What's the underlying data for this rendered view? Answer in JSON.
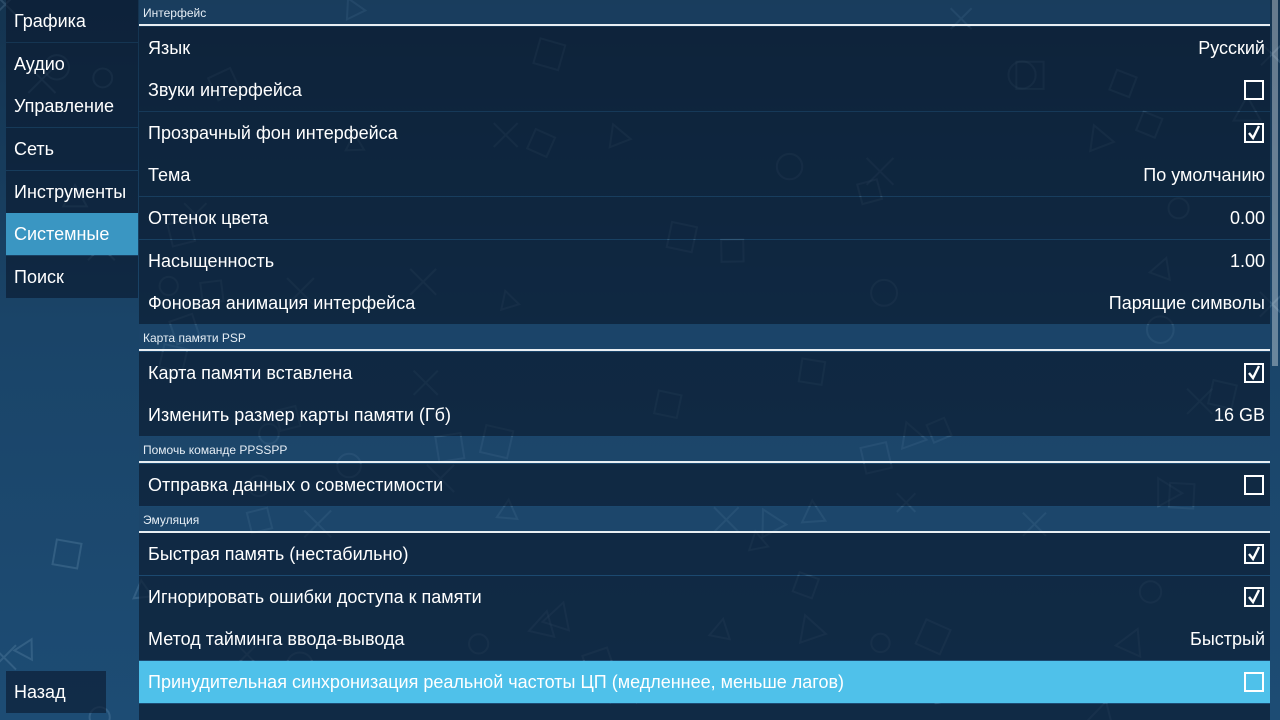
{
  "sidebar": {
    "tabs": [
      {
        "label": "Графика"
      },
      {
        "label": "Аудио"
      },
      {
        "label": "Управление"
      },
      {
        "label": "Сеть"
      },
      {
        "label": "Инструменты"
      },
      {
        "label": "Системные",
        "active": true
      },
      {
        "label": "Поиск"
      }
    ],
    "back_label": "Назад"
  },
  "sections": {
    "interface": {
      "header": "Интерфейс",
      "language": {
        "label": "Язык",
        "value": "Русский"
      },
      "ui_sounds": {
        "label": "Звуки интерфейса",
        "checked": false
      },
      "transparent_bg": {
        "label": "Прозрачный фон интерфейса",
        "checked": true
      },
      "theme": {
        "label": "Тема",
        "value": "По умолчанию"
      },
      "hue": {
        "label": "Оттенок цвета",
        "value": "0.00"
      },
      "saturation": {
        "label": "Насыщенность",
        "value": "1.00"
      },
      "bg_animation": {
        "label": "Фоновая анимация интерфейса",
        "value": "Парящие символы"
      }
    },
    "memstick": {
      "header": "Карта памяти PSP",
      "inserted": {
        "label": "Карта памяти вставлена",
        "checked": true
      },
      "size": {
        "label": "Изменить размер карты памяти (Гб)",
        "value": "16 GB"
      }
    },
    "help": {
      "header": "Помочь команде PPSSPP",
      "compat_report": {
        "label": "Отправка данных о совместимости",
        "checked": false
      }
    },
    "emulation": {
      "header": "Эмуляция",
      "fast_memory": {
        "label": "Быстрая память (нестабильно)",
        "checked": true
      },
      "ignore_errors": {
        "label": "Игнорировать ошибки доступа к памяти",
        "checked": true
      },
      "io_timing": {
        "label": "Метод тайминга ввода-вывода",
        "value": "Быстрый"
      },
      "force_realtime": {
        "label": "Принудительная синхронизация реальной частоты ЦП (медленнее, меньше лагов)",
        "checked": false
      }
    }
  },
  "icons": {
    "checkbox_checked": "check-icon",
    "background": [
      "circle-icon",
      "cross-icon",
      "square-icon",
      "triangle-icon"
    ]
  },
  "colors": {
    "active_tab": "#3a96c2",
    "highlight_row": "#4fc1ea"
  }
}
